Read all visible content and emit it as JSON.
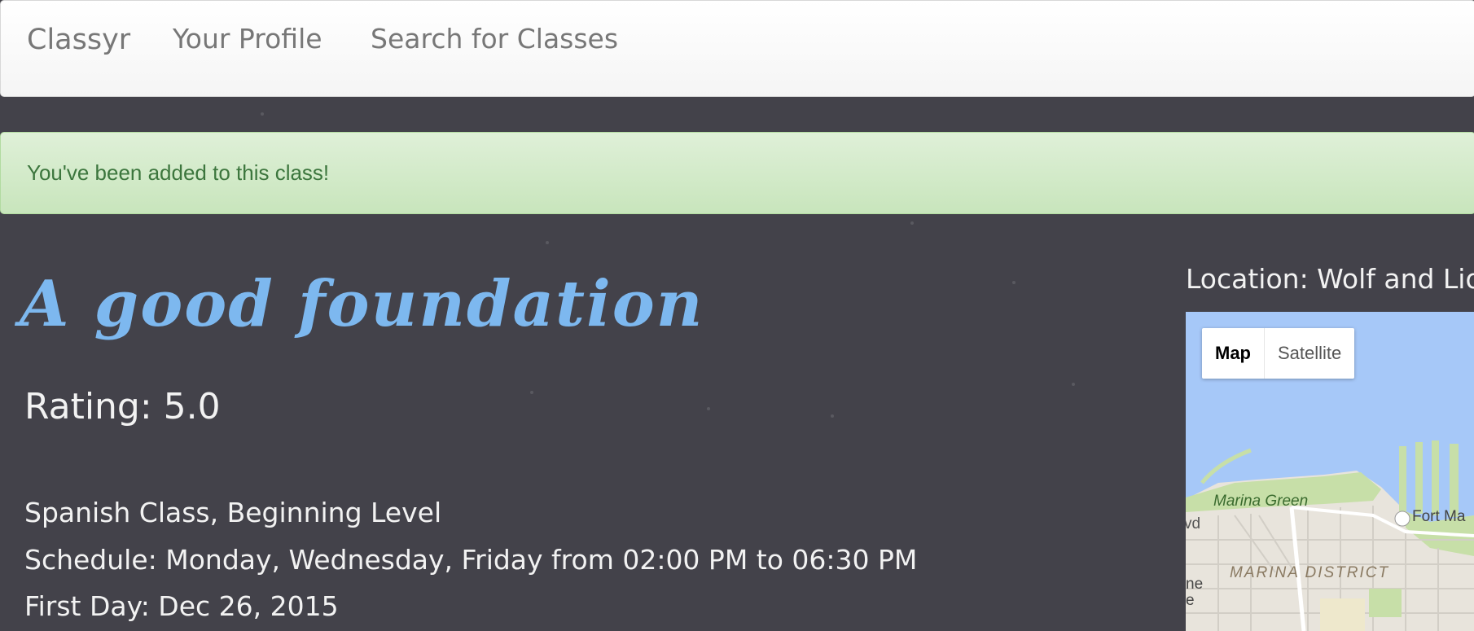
{
  "navbar": {
    "brand": "Classyr",
    "links": [
      "Your Profile",
      "Search for Classes"
    ]
  },
  "alert": {
    "message": "You've been added to this class!"
  },
  "class": {
    "title": "A good foundation",
    "rating": "Rating: 5.0",
    "description": "Spanish Class, Beginning Level",
    "schedule": "Schedule: Monday, Wednesday, Friday from 02:00 PM to 06:30 PM",
    "first_day": "First Day: Dec 26, 2015"
  },
  "location": {
    "label": "Location: Wolf and Lion"
  },
  "map": {
    "buttons": [
      "Map",
      "Satellite"
    ],
    "selected": "Map",
    "labels": {
      "marina_green": "Marina Green",
      "fort_mason": "Fort Ma",
      "marina_district": "MARINA DISTRICT",
      "blvd": "vd",
      "edge_1": "ne",
      "edge_2": "e"
    }
  },
  "colors": {
    "background": "#43424a",
    "title": "#7db8ef",
    "alert_text": "#3c763d",
    "nav_text": "#777777"
  }
}
